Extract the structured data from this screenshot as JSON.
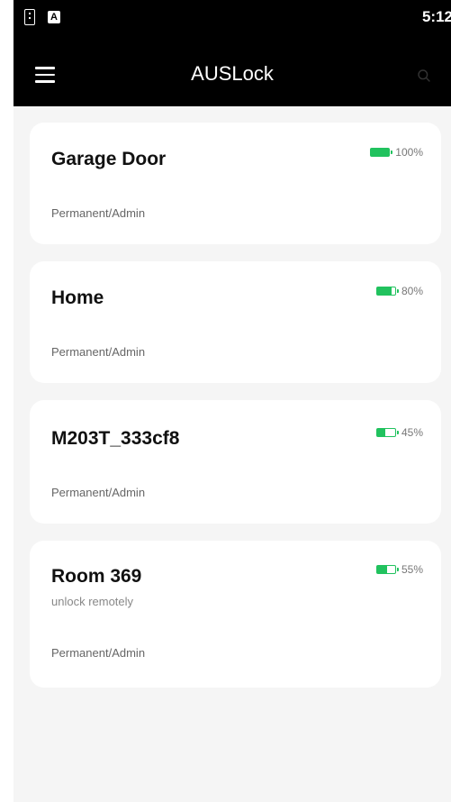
{
  "status_bar": {
    "time": "5:12",
    "icons": [
      "sim-card-icon",
      "notification-a-icon"
    ],
    "notification_letter": "A"
  },
  "app_bar": {
    "title": "AUSLock",
    "left_icon": "hamburger-menu-icon",
    "right_icon": "search-icon"
  },
  "colors": {
    "app_bar_bg": "#000000",
    "battery": "#21c25e",
    "card_bg": "#ffffff",
    "list_bg": "#f5f5f5"
  },
  "locks": [
    {
      "name": "Garage Door",
      "subtitle": "",
      "role": "Permanent/Admin",
      "battery_label": "100%",
      "battery_level": 100
    },
    {
      "name": "Home",
      "subtitle": "",
      "role": "Permanent/Admin",
      "battery_label": "80%",
      "battery_level": 80
    },
    {
      "name": "M203T_333cf8",
      "subtitle": "",
      "role": "Permanent/Admin",
      "battery_label": "45%",
      "battery_level": 45
    },
    {
      "name": "Room 369",
      "subtitle": "unlock remotely",
      "role": "Permanent/Admin",
      "battery_label": "55%",
      "battery_level": 55
    }
  ]
}
